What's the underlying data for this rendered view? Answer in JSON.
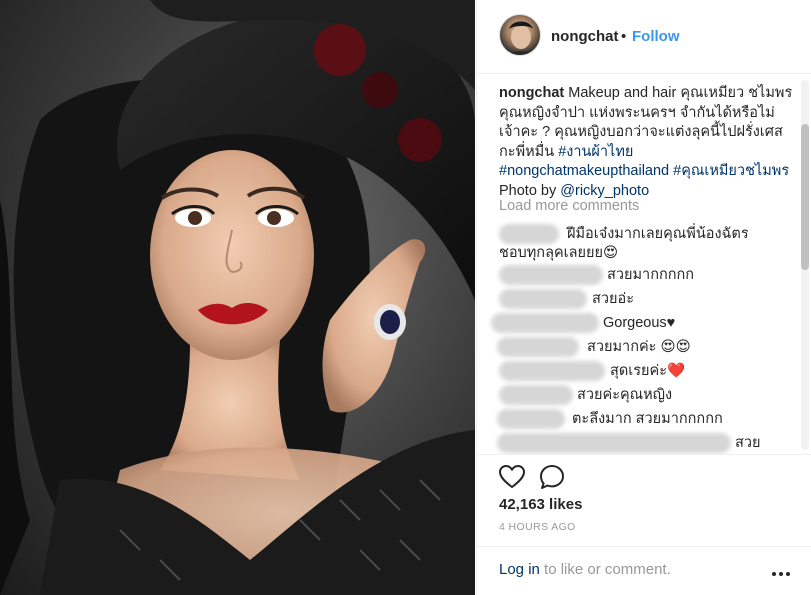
{
  "header": {
    "username": "nongchat",
    "dot": "•",
    "follow_label": "Follow"
  },
  "caption": {
    "username": "nongchat",
    "text_1": "Makeup and hair คุณเหมียว ชไมพร คุณหญิงจำปา แห่งพระนครฯ จำกันได้หรือไม่เจ้าคะ ? คุณหญิงบอกว่าจะแต่งลุคนี้ไปฝรั่งเศสกะพี่หมื่น",
    "tag_1": "#งานผ้าไทย",
    "tag_2": "#nongchatmakeupthailand",
    "tag_3": "#คุณเหมียวชไมพร",
    "photo_by": "Photo by",
    "mention": "@ricky_photo"
  },
  "load_more_label": "Load more comments",
  "comments": [
    {
      "text": "ฝีมือเจ๋งมากเลยคุณพี่น้องฉัตร"
    },
    {
      "text": "ชอบทุกลุคเลยยย😍"
    },
    {
      "text": "สวยมากกกกก"
    },
    {
      "text": "สวยอ่ะ"
    },
    {
      "text": "Gorgeous♥"
    },
    {
      "text": "สวยมากค่ะ 😍😍"
    },
    {
      "text": "สุดเรยค่ะ❤️"
    },
    {
      "text": "สวยค่ะคุณหญิง"
    },
    {
      "text": "ตะลึงมาก สวยมากกกกก"
    },
    {
      "text": "สวย"
    }
  ],
  "icons": {
    "like": "heart-icon",
    "comment": "comment-bubble-icon",
    "more": "more-options-icon"
  },
  "likes": "42,163 likes",
  "time": "4 HOURS AGO",
  "footer": {
    "login_link": "Log in",
    "login_rest": " to like or comment."
  },
  "colors": {
    "link": "#3897f0",
    "hashtag": "#003569",
    "muted": "#999999",
    "lipstick": "#b3141c"
  }
}
